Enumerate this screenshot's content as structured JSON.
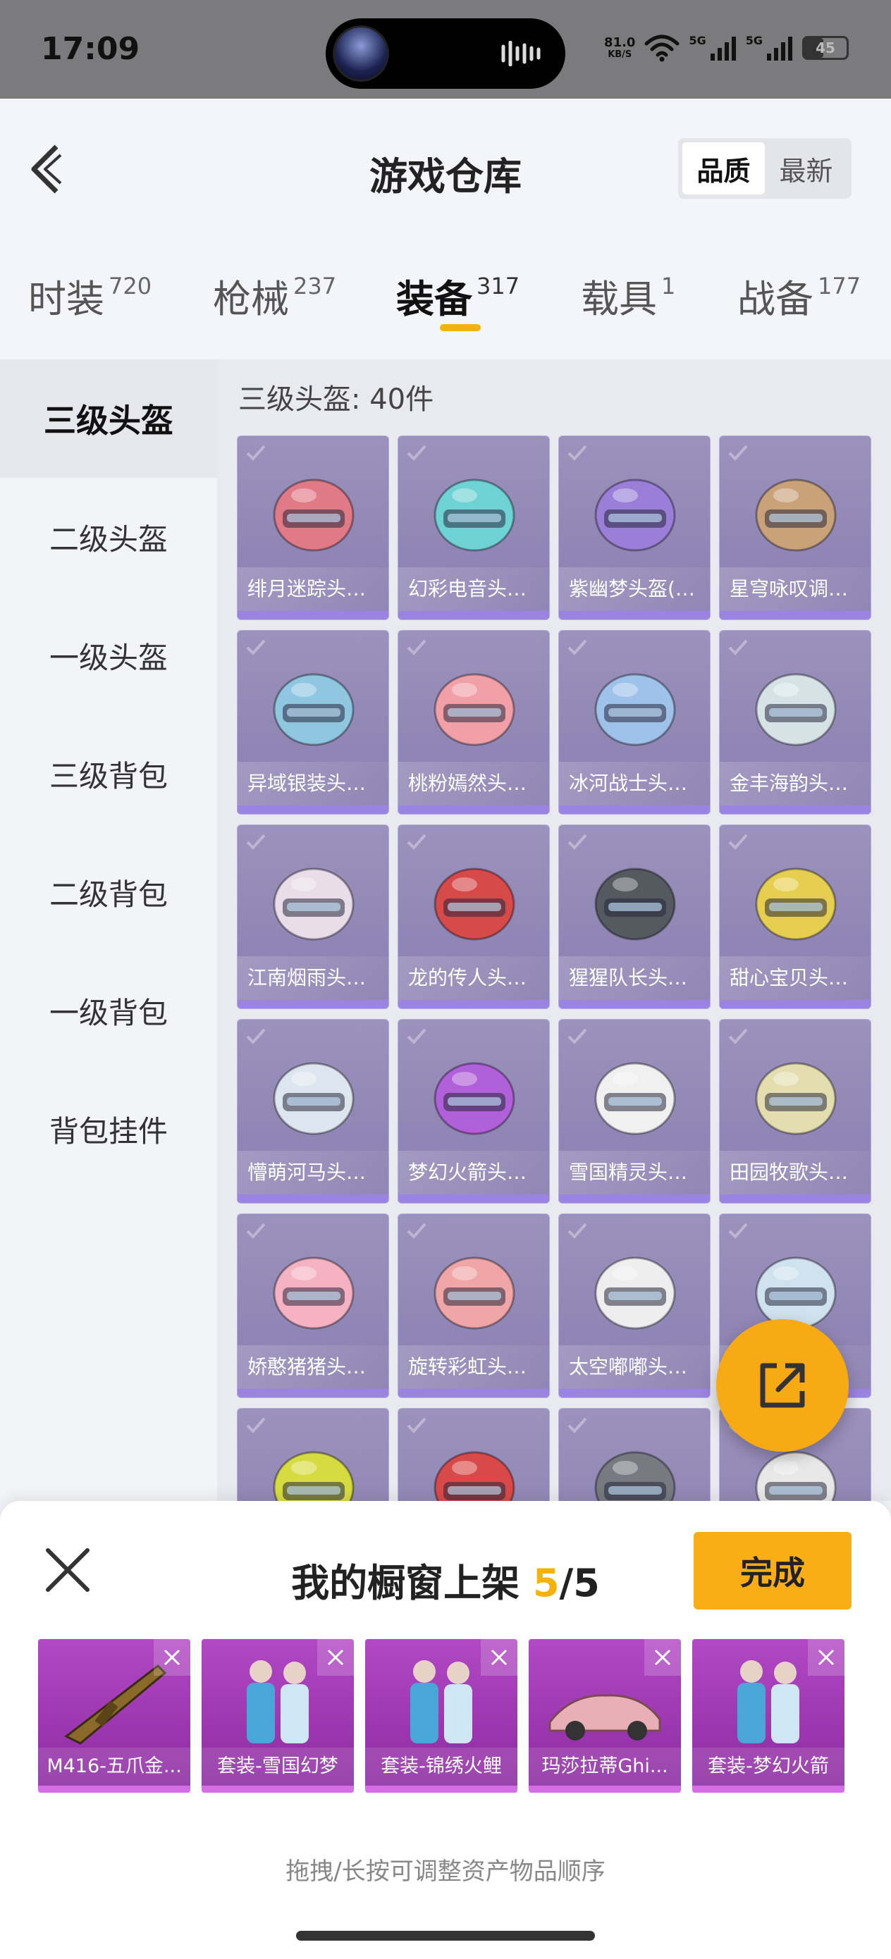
{
  "status": {
    "time": "17:09",
    "net_speed": "81.0",
    "net_unit": "KB/S",
    "signal1_label": "5G",
    "signal2_label": "5G",
    "battery": "45",
    "battery_level": 0.45
  },
  "header": {
    "title": "游戏仓库",
    "sort_quality": "品质",
    "sort_latest": "最新"
  },
  "tabs": [
    {
      "label": "时装",
      "count": "720"
    },
    {
      "label": "枪械",
      "count": "237"
    },
    {
      "label": "装备",
      "count": "317"
    },
    {
      "label": "载具",
      "count": "1"
    },
    {
      "label": "战备",
      "count": "177"
    }
  ],
  "sidebar": {
    "items": [
      {
        "label": "三级头盔"
      },
      {
        "label": "二级头盔"
      },
      {
        "label": "一级头盔"
      },
      {
        "label": "三级背包"
      },
      {
        "label": "二级背包"
      },
      {
        "label": "一级背包"
      },
      {
        "label": "背包挂件"
      }
    ]
  },
  "content": {
    "title": "三级头盔: 40件",
    "items": [
      {
        "name": "绯月迷踪头盔...",
        "icon": "helmet-icon",
        "color": "#e07a86"
      },
      {
        "name": "幻彩电音头盔...",
        "icon": "helmet-icon",
        "color": "#6fd2d4"
      },
      {
        "name": "紫幽梦头盔(3...",
        "icon": "helmet-icon",
        "color": "#9a7ed8"
      },
      {
        "name": "星穹咏叹调头...",
        "icon": "helmet-icon",
        "color": "#c9a27a"
      },
      {
        "name": "异域银装头盔...",
        "icon": "helmet-icon",
        "color": "#8fc6e0"
      },
      {
        "name": "桃粉嫣然头盔...",
        "icon": "helmet-icon",
        "color": "#f2a0a8"
      },
      {
        "name": "冰河战士头盔...",
        "icon": "helmet-icon",
        "color": "#9fc2ea"
      },
      {
        "name": "金丰海韵头盔...",
        "icon": "helmet-icon",
        "color": "#d6e3e6"
      },
      {
        "name": "江南烟雨头盔...",
        "icon": "helmet-icon",
        "color": "#e8dde8"
      },
      {
        "name": "龙的传人头盔...",
        "icon": "helmet-icon",
        "color": "#d64a4a"
      },
      {
        "name": "猩猩队长头盔...",
        "icon": "helmet-icon",
        "color": "#555a60"
      },
      {
        "name": "甜心宝贝头盔...",
        "icon": "helmet-icon",
        "color": "#e6cf50"
      },
      {
        "name": "懵萌河马头盔...",
        "icon": "helmet-icon",
        "color": "#dde6ee"
      },
      {
        "name": "梦幻火箭头盔...",
        "icon": "helmet-icon",
        "color": "#b060d8"
      },
      {
        "name": "雪国精灵头盔...",
        "icon": "helmet-icon",
        "color": "#f0f0f0"
      },
      {
        "name": "田园牧歌头盔...",
        "icon": "helmet-icon",
        "color": "#e4ddb0"
      },
      {
        "name": "娇憨猪猪头盔...",
        "icon": "helmet-icon",
        "color": "#f4b2c2"
      },
      {
        "name": "旋转彩虹头盔...",
        "icon": "helmet-icon",
        "color": "#f0a6a6"
      },
      {
        "name": "太空嘟嘟头盔...",
        "icon": "helmet-icon",
        "color": "#eeeeee"
      },
      {
        "name": "",
        "icon": "helmet-icon",
        "color": "#cfe2ee"
      },
      {
        "name": "",
        "icon": "helmet-icon",
        "color": "#d6dc40"
      },
      {
        "name": "",
        "icon": "helmet-icon",
        "color": "#d84a4a"
      },
      {
        "name": "",
        "icon": "helmet-icon",
        "color": "#777a80"
      },
      {
        "name": "",
        "icon": "helmet-icon",
        "color": "#e8e8e8"
      }
    ]
  },
  "share_button_icon": "share-external-icon",
  "sheet": {
    "title_prefix": "我的橱窗上架 ",
    "current": "5",
    "separator_total": "/5",
    "done_label": "完成",
    "hint": "拖拽/长按可调整资产物品顺序",
    "items": [
      {
        "name": "M416-五爪金...",
        "icon": "rifle-icon"
      },
      {
        "name": "套装-雪国幻梦",
        "icon": "outfit-icon"
      },
      {
        "name": "套装-锦绣火鲤",
        "icon": "outfit-icon"
      },
      {
        "name": "玛莎拉蒂Ghi...",
        "icon": "car-icon"
      },
      {
        "name": "套装-梦幻火箭",
        "icon": "outfit-icon"
      }
    ]
  }
}
